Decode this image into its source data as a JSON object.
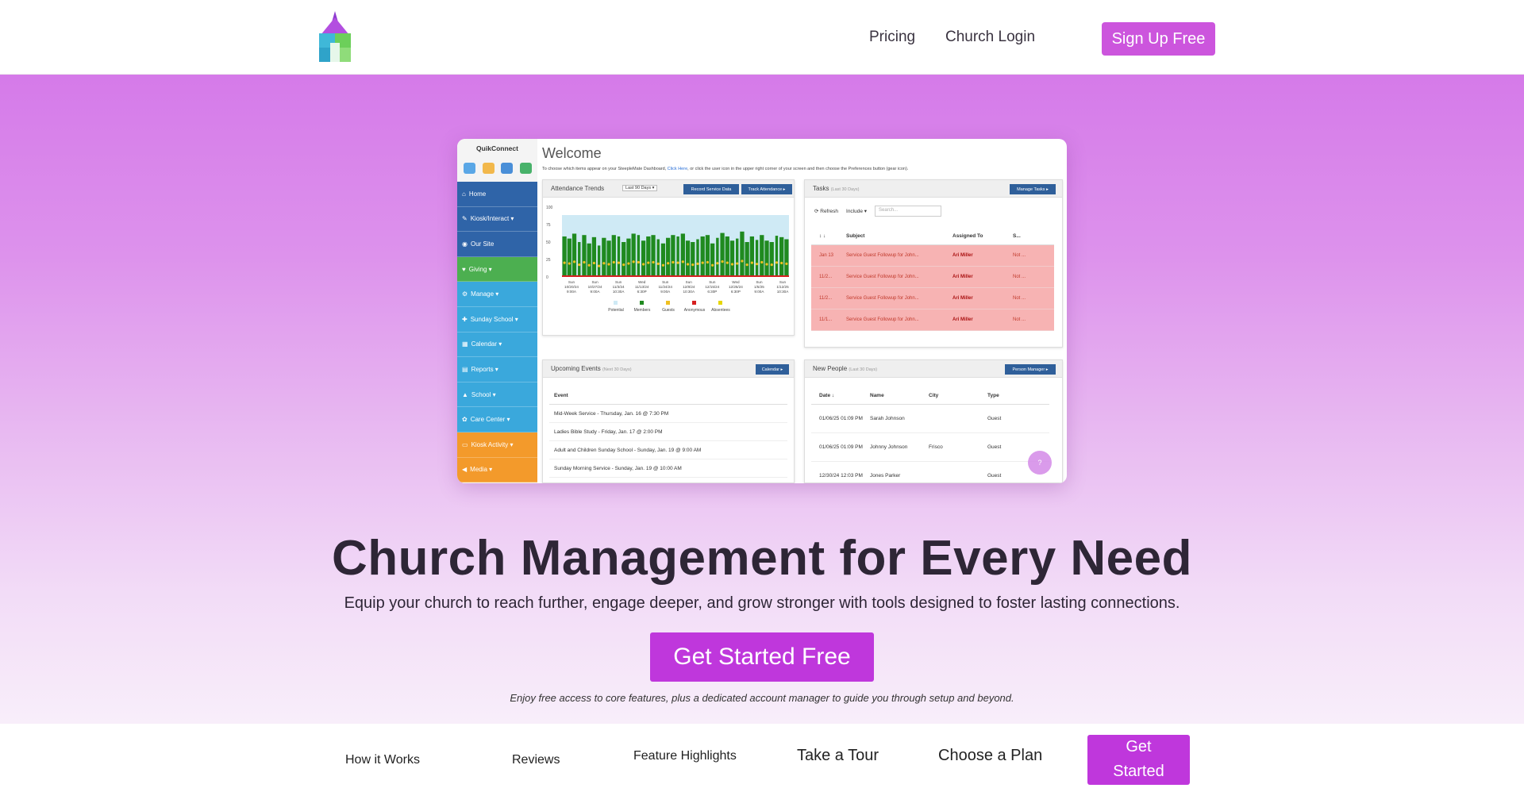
{
  "nav": {
    "pricing": "Pricing",
    "login": "Church Login",
    "signup": "Sign Up Free"
  },
  "colors": {
    "brand": "#bf37dc",
    "signup": "#cc55dd"
  },
  "screenshot": {
    "app_title": "QuikConnect",
    "welcome": "Welcome",
    "hint_prefix": "To choose which items appear on your SteepleMate Dashboard, ",
    "hint_link": "Click Here",
    "hint_suffix": ", or click the user icon in the upper right corner of your screen and then choose the Preferences button (gear icon).",
    "menu": [
      {
        "label": "Home",
        "icon": "home-icon",
        "glyph": "⌂",
        "color": "#2f64a8"
      },
      {
        "label": "Kiosk/Interact ▾",
        "icon": "kiosk-icon",
        "glyph": "✎",
        "color": "#2f64a8"
      },
      {
        "label": "Our Site",
        "icon": "globe-icon",
        "glyph": "◉",
        "color": "#2f64a8"
      },
      {
        "label": "Giving ▾",
        "icon": "giving-icon",
        "glyph": "♥",
        "color": "#4caf50"
      },
      {
        "label": "Manage ▾",
        "icon": "gear-icon",
        "glyph": "⚙",
        "color": "#3aa8dc"
      },
      {
        "label": "Sunday School ▾",
        "icon": "school-icon",
        "glyph": "✚",
        "color": "#3aa8dc"
      },
      {
        "label": "Calendar ▾",
        "icon": "calendar-icon",
        "glyph": "▦",
        "color": "#3aa8dc"
      },
      {
        "label": "Reports ▾",
        "icon": "reports-icon",
        "glyph": "▤",
        "color": "#3aa8dc"
      },
      {
        "label": "School ▾",
        "icon": "graduation-icon",
        "glyph": "▲",
        "color": "#3aa8dc"
      },
      {
        "label": "Care Center ▾",
        "icon": "care-icon",
        "glyph": "✿",
        "color": "#3aa8dc"
      },
      {
        "label": "Kiosk Activity ▾",
        "icon": "kiosk-activity-icon",
        "glyph": "▭",
        "color": "#f39a2b"
      },
      {
        "label": "Media ▾",
        "icon": "megaphone-icon",
        "glyph": "◀",
        "color": "#f39a2b"
      }
    ],
    "attendance": {
      "title": "Attendance Trends",
      "range": "Last 90 Days ▾",
      "btn_service": "Record Service Data",
      "btn_track": "Track Attendance ▸",
      "y_ticks": [
        "100",
        "75",
        "50",
        "25",
        "0"
      ],
      "x_labels": [
        [
          "Sun",
          "10/20/24",
          "9:00A"
        ],
        [
          "Sun",
          "10/27/24",
          "9:00A"
        ],
        [
          "Sun",
          "11/3/24",
          "10:30A"
        ],
        [
          "Wed",
          "11/13/24",
          "6:30P"
        ],
        [
          "Sun",
          "11/24/24",
          "9:00A"
        ],
        [
          "Sun",
          "12/8/24",
          "10:30A"
        ],
        [
          "Sun",
          "12/15/24",
          "6:30P"
        ],
        [
          "Wed",
          "12/25/24",
          "6:30P"
        ],
        [
          "Sun",
          "1/5/25",
          "9:00A"
        ],
        [
          "Sun",
          "1/12/25",
          "10:30A"
        ]
      ],
      "legend": [
        "Potential",
        "Members",
        "Guests",
        "Anonymous",
        "Absentees"
      ],
      "legend_colors": [
        "#cfeaf5",
        "#1f8a1f",
        "#f0c020",
        "#d62020",
        "#e6d600"
      ],
      "members": [
        58,
        55,
        62,
        50,
        60,
        48,
        57,
        45,
        56,
        52,
        60,
        58,
        50,
        55,
        62,
        60,
        52,
        58,
        60,
        54,
        48,
        56,
        60,
        58,
        62,
        52,
        50,
        54,
        58,
        60,
        48,
        56,
        63,
        58,
        52,
        55,
        65,
        50,
        58,
        53,
        60,
        52,
        50,
        59,
        57,
        54
      ]
    },
    "tasks": {
      "title": "Tasks",
      "sub": "(Last 30 Days)",
      "btn": "Manage Tasks ▸",
      "refresh": "⟳ Refresh",
      "include": "Include ▾",
      "search": "Search...",
      "cols": [
        "↕ ↓",
        "Subject",
        "Assigned To",
        "S..."
      ],
      "rows": [
        {
          "date": "Jan 13",
          "subject": "Service Guest Followup for John...",
          "who": "Ari Miller",
          "status": "Not ..."
        },
        {
          "date": "11/2...",
          "subject": "Service Guest Followup for John...",
          "who": "Ari Miller",
          "status": "Not ..."
        },
        {
          "date": "11/2...",
          "subject": "Service Guest Followup for John...",
          "who": "Ari Miller",
          "status": "Not ..."
        },
        {
          "date": "11/1...",
          "subject": "Service Guest Followup for John...",
          "who": "Ari Miller",
          "status": "Not ..."
        }
      ]
    },
    "events": {
      "title": "Upcoming Events",
      "sub": "(Next 30 Days)",
      "btn": "Calendar ▸",
      "col": "Event",
      "rows": [
        "Mid-Week Service - Thursday, Jan. 16 @ 7:30 PM",
        "Ladies Bible Study - Friday, Jan. 17 @ 2:00 PM",
        "Adult and Children Sunday School - Sunday, Jan. 19 @ 9:00 AM",
        "Sunday Morning Service - Sunday, Jan. 19 @ 10:00 AM"
      ]
    },
    "people": {
      "title": "New People",
      "sub": "(Last 30 Days)",
      "btn": "Person Manager ▸",
      "cols": [
        "Date ↓",
        "Name",
        "City",
        "Type"
      ],
      "rows": [
        {
          "date": "01/06/25 01:09 PM",
          "name": "Sarah Johnson",
          "city": "",
          "type": "Guest"
        },
        {
          "date": "01/06/25 01:09 PM",
          "name": "Johnny Johnson",
          "city": "Frisco",
          "type": "Guest"
        },
        {
          "date": "12/30/24 12:03 PM",
          "name": "Jones Parker",
          "city": "",
          "type": "Guest"
        }
      ]
    },
    "help": "?"
  },
  "hero": {
    "headline": "Church Management for Every Need",
    "subline": "Equip your church to reach further, engage deeper, and grow stronger with tools designed to foster lasting connections.",
    "cta": "Get Started Free",
    "note": "Enjoy free access to core features, plus a dedicated account manager to guide you through setup and beyond."
  },
  "strip": {
    "how": "How it Works",
    "reviews": "Reviews",
    "features": "Feature Highlights",
    "tour": "Take a Tour",
    "plan": "Choose a Plan",
    "btn_line1": "Get",
    "btn_line2": "Started"
  }
}
